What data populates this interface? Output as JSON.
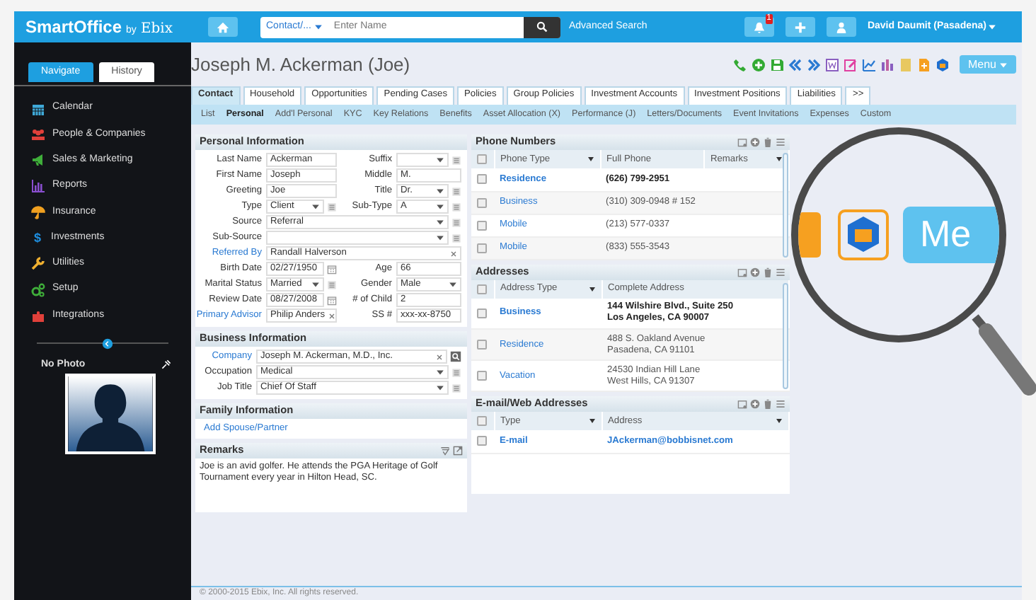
{
  "topbar": {
    "logo": "SmartOffice",
    "logo_by": "by",
    "logo_brand": "Ebix",
    "search_scope": "Contact/...",
    "search_placeholder": "Enter Name",
    "advanced_search": "Advanced Search",
    "notification_count": "1",
    "user": "David Daumit (Pasadena)"
  },
  "sidebar": {
    "tabs": [
      {
        "label": "Navigate",
        "selected": true
      },
      {
        "label": "History",
        "selected": false
      }
    ],
    "items": [
      {
        "label": "Calendar",
        "kind": "calendar",
        "color": "#3fa9d8"
      },
      {
        "label": "People & Companies",
        "kind": "people",
        "color": "#e0403a"
      },
      {
        "label": "Sales & Marketing",
        "kind": "megaphone",
        "color": "#3fae3a"
      },
      {
        "label": "Reports",
        "kind": "reports",
        "color": "#8a4fd0"
      },
      {
        "label": "Insurance",
        "kind": "umbrella",
        "color": "#f0a020"
      },
      {
        "label": "Investments",
        "kind": "glyph",
        "glyph": "$",
        "color": "#1e8fe0"
      },
      {
        "label": "Utilities",
        "kind": "wrench",
        "color": "#f0b030"
      },
      {
        "label": "Setup",
        "kind": "gears",
        "color": "#3fae3a"
      },
      {
        "label": "Integrations",
        "kind": "puzzle",
        "color": "#e0403a"
      }
    ],
    "photo_label": "No Photo"
  },
  "contact": {
    "title": "Joseph M. Ackerman (Joe)",
    "menu": "Menu",
    "tabs": [
      {
        "label": "Contact",
        "selected": true
      },
      {
        "label": "Household",
        "selected": false
      },
      {
        "label": "Opportunities",
        "selected": false
      },
      {
        "label": "Pending Cases",
        "selected": false
      },
      {
        "label": "Policies",
        "selected": false
      },
      {
        "label": "Group Policies",
        "selected": false
      },
      {
        "label": "Investment Accounts",
        "selected": false
      },
      {
        "label": "Investment Positions",
        "selected": false
      },
      {
        "label": "Liabilities",
        "selected": false
      },
      {
        "label": ">>",
        "selected": false
      }
    ],
    "subtabs": [
      {
        "label": "List",
        "selected": false
      },
      {
        "label": "Personal",
        "selected": true
      },
      {
        "label": "Add'l Personal",
        "selected": false
      },
      {
        "label": "KYC",
        "selected": false
      },
      {
        "label": "Key Relations",
        "selected": false
      },
      {
        "label": "Benefits",
        "selected": false
      },
      {
        "label": "Asset Allocation (X)",
        "selected": false
      },
      {
        "label": "Performance (J)",
        "selected": false
      },
      {
        "label": "Letters/Documents",
        "selected": false
      },
      {
        "label": "Event Invitations",
        "selected": false
      },
      {
        "label": "Expenses",
        "selected": false
      },
      {
        "label": "Custom",
        "selected": false
      }
    ]
  },
  "personal": {
    "title": "Personal Information",
    "rows": [
      [
        {
          "label": "Last Name",
          "value": "Ackerman",
          "kind": "text",
          "link": false
        },
        {
          "label": "Suffix",
          "kind": "select-list",
          "link": false
        }
      ],
      [
        {
          "label": "First Name",
          "value": "Joseph",
          "kind": "text",
          "link": false
        },
        {
          "label": "Middle",
          "value": "M.",
          "kind": "text",
          "link": false
        }
      ],
      [
        {
          "label": "Greeting",
          "value": "Joe",
          "kind": "text",
          "link": false
        },
        {
          "label": "Title",
          "value": "Dr.",
          "kind": "select-list",
          "link": false
        }
      ],
      [
        {
          "label": "Type",
          "value": "Client",
          "kind": "select-list",
          "link": false
        },
        {
          "label": "Sub-Type",
          "value": "A",
          "kind": "select-list",
          "link": false
        }
      ],
      [
        {
          "label": "Source",
          "value": "Referral",
          "kind": "select-list",
          "link": false
        }
      ],
      [
        {
          "label": "Sub-Source",
          "kind": "select-list",
          "link": false
        }
      ],
      [
        {
          "label": "Referred By",
          "value": "Randall Halverson",
          "kind": "clear",
          "link": true
        }
      ],
      [
        {
          "label": "Birth Date",
          "value": "02/27/1950",
          "kind": "date",
          "link": false
        },
        {
          "label": "Age",
          "value": "66",
          "kind": "text",
          "link": false
        }
      ],
      [
        {
          "label": "Marital Status",
          "value": "Married",
          "kind": "select-list",
          "link": false
        },
        {
          "label": "Gender",
          "value": "Male",
          "kind": "select",
          "link": false
        }
      ],
      [
        {
          "label": "Review Date",
          "value": "08/27/2008",
          "kind": "date",
          "link": false
        },
        {
          "label": "# of Child",
          "value": "2",
          "kind": "text",
          "link": false
        }
      ],
      [
        {
          "label": "Primary Advisor",
          "value": "Philip Anders",
          "kind": "clear",
          "link": true
        },
        {
          "label": "SS #",
          "value": "xxx-xx-8750",
          "kind": "text",
          "link": false
        }
      ]
    ]
  },
  "business": {
    "title": "Business Information",
    "rows": [
      [
        {
          "label": "Company",
          "value": "Joseph M. Ackerman, M.D., Inc.",
          "kind": "clear-lookup",
          "link": true
        }
      ],
      [
        {
          "label": "Occupation",
          "value": "Medical",
          "kind": "select-list",
          "link": false
        }
      ],
      [
        {
          "label": "Job Title",
          "value": "Chief Of Staff",
          "kind": "select-list",
          "link": false
        }
      ]
    ]
  },
  "family": {
    "title": "Family Information",
    "link": "Add Spouse/Partner"
  },
  "remarks": {
    "title": "Remarks",
    "text": "Joe is an avid golfer. He attends the PGA Heritage of Golf Tournament every year in Hilton Head, SC."
  },
  "phones": {
    "title": "Phone Numbers",
    "all_checked": false,
    "columns": [
      {
        "label": "Phone Type",
        "filter": true
      },
      {
        "label": "Full Phone",
        "filter": false
      },
      {
        "label": "Remarks",
        "filter": true
      }
    ],
    "rows": [
      {
        "type": "Residence",
        "value": "(626) 799-2951",
        "primary": true,
        "checked": false
      },
      {
        "type": "Business",
        "value": "(310) 309-0948 # 152",
        "primary": false,
        "checked": false
      },
      {
        "type": "Mobile",
        "value": "(213) 577-0337",
        "primary": false,
        "checked": false
      },
      {
        "type": "Mobile",
        "value": "(833) 555-3543",
        "primary": false,
        "checked": false
      }
    ]
  },
  "addresses": {
    "title": "Addresses",
    "all_checked": false,
    "columns": [
      {
        "label": "Address Type",
        "filter": true
      },
      {
        "label": "Complete Address",
        "filter": false
      }
    ],
    "rows": [
      {
        "type": "Business",
        "lines": [
          "144 Wilshire Blvd., Suite 250",
          "Los Angeles, CA 90007"
        ],
        "primary": true,
        "checked": false
      },
      {
        "type": "Residence",
        "lines": [
          "488 S. Oakland Avenue",
          "Pasadena, CA 91101"
        ],
        "primary": false,
        "checked": false
      },
      {
        "type": "Vacation",
        "lines": [
          "24530 Indian Hill Lane",
          "West Hills, CA 91307"
        ],
        "primary": false,
        "checked": false
      }
    ]
  },
  "emails": {
    "title": "E-mail/Web Addresses",
    "all_checked": false,
    "columns": [
      {
        "label": "Type",
        "filter": true
      },
      {
        "label": "Address",
        "filter": true
      }
    ],
    "rows": [
      {
        "type": "E-mail",
        "value": "JAckerman@bobbisnet.com",
        "primary": true,
        "checked": false
      }
    ]
  },
  "footer": "© 2000-2015 Ebix, Inc. All rights reserved.",
  "magnifier": {
    "text": "Me"
  }
}
